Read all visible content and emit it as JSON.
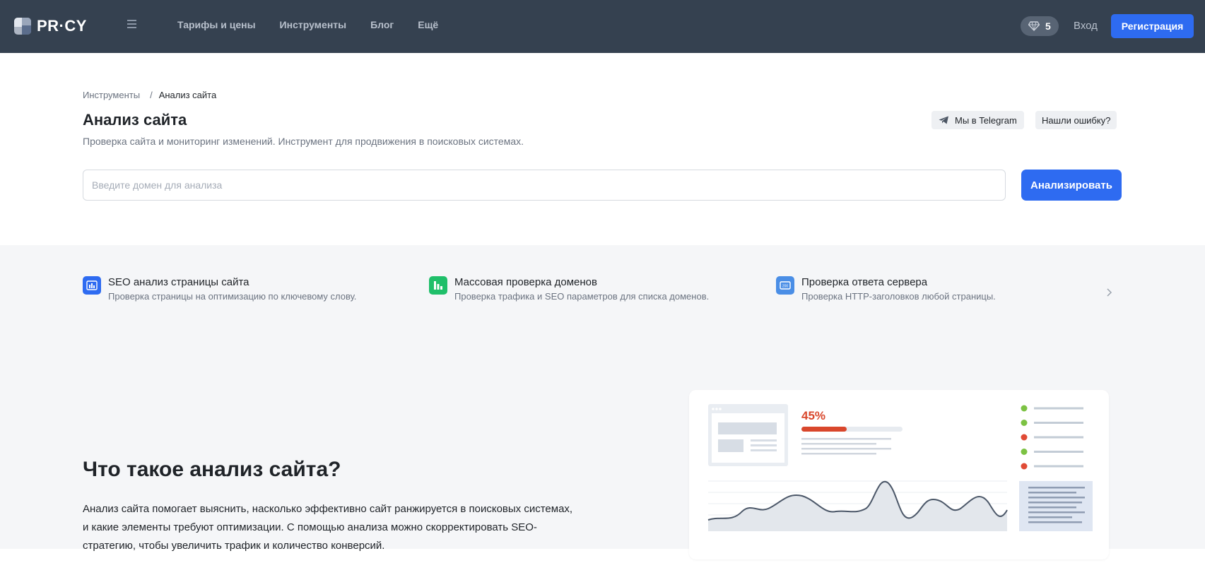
{
  "header": {
    "logo_text": "PR·CY",
    "nav": [
      "Тарифы и цены",
      "Инструменты",
      "Блог",
      "Ещё"
    ],
    "gem_count": "5",
    "login": "Вход",
    "register": "Регистрация"
  },
  "breadcrumb": {
    "parent": "Инструменты",
    "separator": "/",
    "current": "Анализ сайта"
  },
  "page": {
    "title": "Анализ сайта",
    "subtitle": "Проверка сайта и мониторинг изменений. Инструмент для продвижения в поисковых системах.",
    "telegram_label": "Мы в Telegram",
    "report_error_label": "Нашли ошибку?",
    "search_placeholder": "Введите домен для анализа",
    "search_value": "",
    "analyze_label": "Анализировать"
  },
  "tools": [
    {
      "title": "SEO анализ страницы сайта",
      "desc": "Проверка страницы на оптимизацию по ключевому слову.",
      "color": "#2e6bf1",
      "icon": "page-chart-icon"
    },
    {
      "title": "Массовая проверка доменов",
      "desc": "Проверка трафика и SEO параметров для списка доменов.",
      "color": "#1fbf6a",
      "icon": "bars-icon"
    },
    {
      "title": "Проверка ответа сервера",
      "desc": "Проверка HTTP-заголовков любой страницы.",
      "color": "#4a8ee6",
      "icon": "server-response-icon"
    }
  ],
  "about": {
    "title": "Что такое анализ сайта?",
    "text": "Анализ сайта помогает выяснить, насколько эффективно сайт ранжируется в поисковых системах, и какие элементы требуют оптимизации. С помощью анализа можно скорректировать SEO-стратегию, чтобы увеличить трафик и количество конверсий."
  },
  "illustration": {
    "percent_label": "45%",
    "progress": 0.45,
    "status_dots": [
      "#7cc243",
      "#7cc243",
      "#e04a35",
      "#7cc243",
      "#e04a35"
    ],
    "accent_color": "#d9472c"
  },
  "colors": {
    "header_bg": "#354150",
    "primary": "#2e6bf1",
    "grey_bg": "#f5f6f8"
  }
}
